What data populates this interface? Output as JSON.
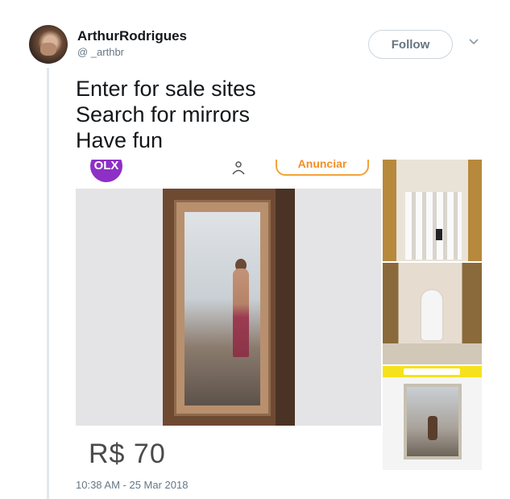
{
  "user": {
    "name": "ArthurRodrigues",
    "handle": "@ _arthbr"
  },
  "header": {
    "follow_label": "Follow"
  },
  "tweet": {
    "lines": [
      "Enter for sale sites",
      "Search for mirrors",
      "Have fun"
    ],
    "timestamp": "10:38 AM - 25 Mar 2018"
  },
  "media": {
    "main": {
      "logo_text": "OLX",
      "anunciar_label": "Anunciar",
      "price": "R$ 70"
    },
    "thumbs": [
      {
        "icon": "mirror-photo"
      },
      {
        "icon": "mirror-photo"
      },
      {
        "icon": "mirror-photo"
      }
    ]
  },
  "colors": {
    "olx_purple": "#8e2fc5",
    "anunciar_orange": "#f28f24",
    "thread_line": "#e1e8ed",
    "muted_text": "#657786"
  }
}
